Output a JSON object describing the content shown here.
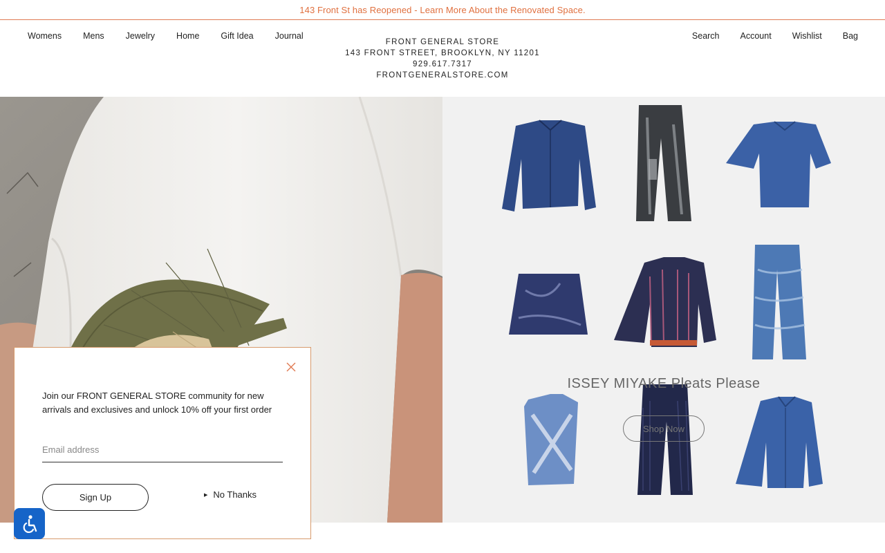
{
  "announcement": {
    "text": "143 Front St has Reopened - Learn More About the Renovated Space."
  },
  "nav": {
    "left": [
      "Womens",
      "Mens",
      "Jewelry",
      "Home",
      "Gift Idea",
      "Journal"
    ],
    "right": [
      "Search",
      "Account",
      "Wishlist",
      "Bag"
    ]
  },
  "store": {
    "name": "FRONT GENERAL STORE",
    "address": "143 FRONT STREET, BROOKLYN, NY 11201",
    "phone": "929.617.7317",
    "website": "FRONTGENERALSTORE.COM"
  },
  "hero": {
    "title": "ISSEY MIYAKE Pleats Please",
    "cta": "Shop Now",
    "products": [
      "denim-jacket",
      "printed-trousers",
      "denim-short-sleeve-shirt",
      "mini-skirt",
      "striped-jacket",
      "pleated-pants",
      "printed-vest",
      "dark-pleated-pants",
      "blue-cardigan"
    ]
  },
  "popup": {
    "message": "Join our FRONT GENERAL STORE community for new arrivals and exclusives and unlock 10% off your first order",
    "email_placeholder": "Email address",
    "email_value": "",
    "signup_label": "Sign Up",
    "no_thanks_label": "No Thanks",
    "border_color": "#d79a6c"
  },
  "colors": {
    "accent": "#e0703f",
    "accessibility": "#1664c8"
  },
  "icons": {
    "close": "close-icon",
    "accessibility": "accessibility-icon"
  }
}
